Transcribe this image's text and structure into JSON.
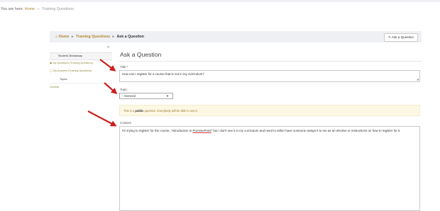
{
  "top_breadcrumb": {
    "prefix": "You are here:",
    "home": "Home",
    "separator": "»",
    "current": "Training Questions"
  },
  "header": {
    "home": "Home",
    "training_questions": "Training Questions",
    "current": "Ask a Question",
    "ask_button": "Ask a Question",
    "ask_icon": "pencil-icon"
  },
  "sidebar": {
    "collapse": "«",
    "items": [
      {
        "label": "Student1 Breakaway",
        "icon": ""
      },
      {
        "label": "My Questions (Training Questions)",
        "icon": "folder-icon"
      },
      {
        "label": "My Answers (Training Questions)",
        "icon": "speech-bubble-icon"
      },
      {
        "label": "Topics",
        "icon": ""
      },
      {
        "label": "General",
        "icon": ""
      }
    ]
  },
  "form": {
    "page_title": "Ask a Question",
    "title_label": "Title *",
    "title_value": "How can I register for a course that is not in my curriculum?",
    "topic_label": "Topic",
    "topic_value": "-- General",
    "notice_prefix": "This is a ",
    "notice_strong": "public",
    "notice_suffix": " question. Everybody will be able to see it.",
    "content_label": "Content",
    "content_part1": "I'm trying to register for the course, \"Introduction to ",
    "content_underlined": "PromisePoint",
    "content_part2": "\" but I don't see it in my curriculum and need to either have someone assign it to me as an elective or instructions on how to register for it."
  },
  "colors": {
    "accent_gold": "#b28a2f",
    "annotation_arrow": "#c8201e",
    "notice_bg": "#fcf8e4"
  }
}
